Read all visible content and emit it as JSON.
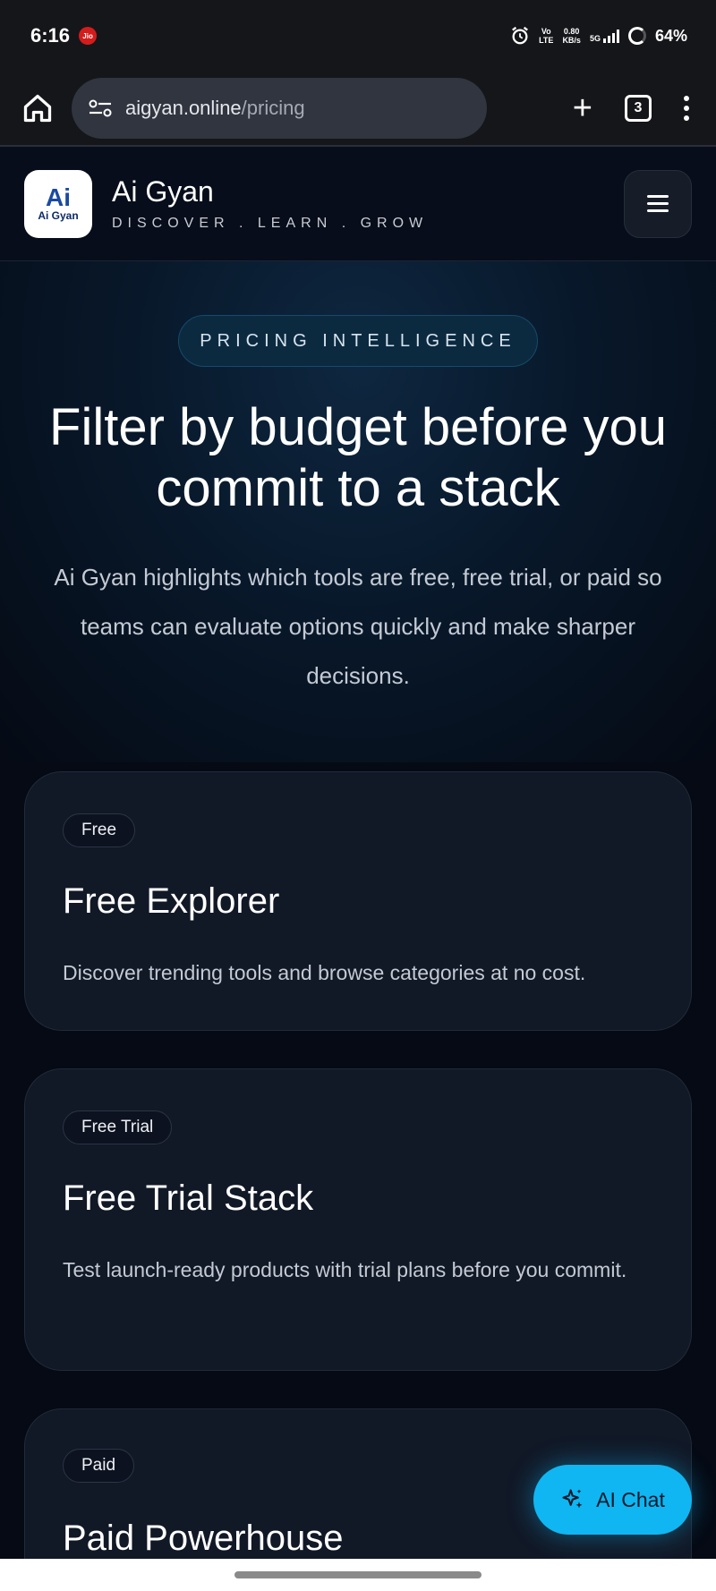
{
  "status_bar": {
    "time": "6:16",
    "carrier_icon": "Jio",
    "volte": "Voł\nLTE",
    "speed_value": "0.80",
    "speed_unit": "KB/s",
    "network": "5G",
    "battery": "64%"
  },
  "browser": {
    "url_domain": "aigyan.online",
    "url_path": "/pricing",
    "tab_count": "3"
  },
  "site": {
    "logo_ai": "Ai",
    "logo_sub": "Ai Gyan",
    "brand_name": "Ai Gyan",
    "tagline": "DISCOVER . LEARN . GROW"
  },
  "hero": {
    "badge": "PRICING INTELLIGENCE",
    "title": "Filter by budget before you commit to a stack",
    "description": "Ai Gyan highlights which tools are free, free trial, or paid so teams can evaluate options quickly and make sharper decisions."
  },
  "cards": [
    {
      "chip": "Free",
      "title": "Free Explorer",
      "description": "Discover trending tools and browse categories at no cost."
    },
    {
      "chip": "Free Trial",
      "title": "Free Trial Stack",
      "description": "Test launch-ready products with trial plans before you commit."
    },
    {
      "chip": "Paid",
      "title": "Paid Powerhouse",
      "description": ""
    }
  ],
  "ai_chat": {
    "label": "AI Chat"
  },
  "colors": {
    "accent": "#0fb6f2",
    "background": "#050a14",
    "card": "#111826"
  }
}
